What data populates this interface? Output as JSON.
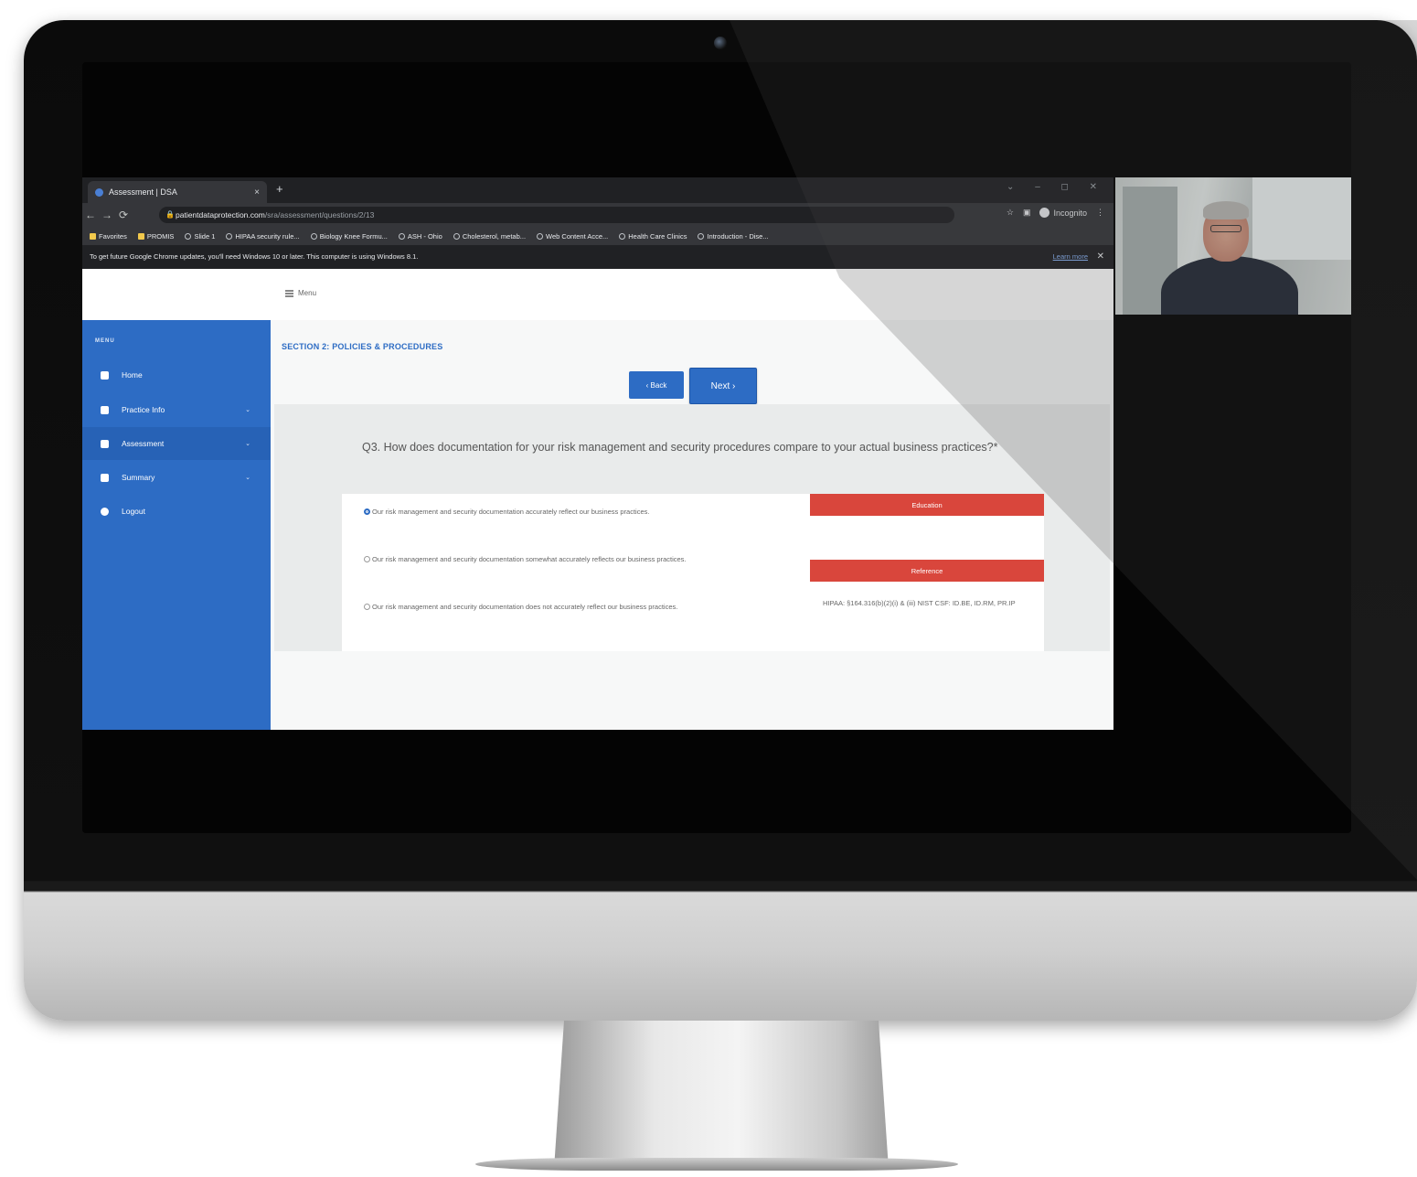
{
  "browser": {
    "tab_title": "Assessment | DSA",
    "tab_close": "×",
    "new_tab": "+",
    "window_controls": "⌄ – ◻ ✕",
    "url_host": "patientdataprotection.com",
    "url_path": "/sra/assessment/questions/2/13",
    "profile_label": "Incognito",
    "bookmarks": [
      "Favorites",
      "PROMIS",
      "Slide 1",
      "HIPAA security rule...",
      "Biology Knee Formu...",
      "ASH - Ohio",
      "Cholesterol, metab...",
      "Web Content Acce...",
      "Health Care Clinics",
      "Introduction - Dise..."
    ],
    "infobar_text": "To get future Google Chrome updates, you'll need Windows 10 or later. This computer is using Windows 8.1.",
    "infobar_link": "Learn more",
    "infobar_close": "✕"
  },
  "topbar": {
    "menu_label": "Menu"
  },
  "sidebar": {
    "heading": "MENU",
    "items": [
      {
        "label": "Home",
        "chevron": ""
      },
      {
        "label": "Practice Info",
        "chevron": "⌄"
      },
      {
        "label": "Assessment",
        "chevron": "⌄"
      },
      {
        "label": "Summary",
        "chevron": "⌄"
      },
      {
        "label": "Logout",
        "chevron": ""
      }
    ]
  },
  "content": {
    "section_title": "SECTION 2: POLICIES & PROCEDURES",
    "back_label": "‹ Back",
    "next_label": "Next ›",
    "question": "Q3. How does documentation for your risk management and security procedures compare to your actual business practices?*",
    "answers": [
      {
        "text": "Our risk management and security documentation accurately reflect our business practices.",
        "selected": true
      },
      {
        "text": "Our risk management and security documentation somewhat accurately reflects our business practices.",
        "selected": false
      },
      {
        "text": "Our risk management and security documentation does not accurately reflect our business practices.",
        "selected": false
      }
    ],
    "education_label": "Education",
    "reference_label": "Reference",
    "reference_text": "HIPAA: §164.316(b)(2)(i) & (iii) NIST CSF: ID.BE, ID.RM, PR.IP"
  },
  "colors": {
    "primary": "#2d6cc4",
    "accent_red": "#d9463c"
  }
}
